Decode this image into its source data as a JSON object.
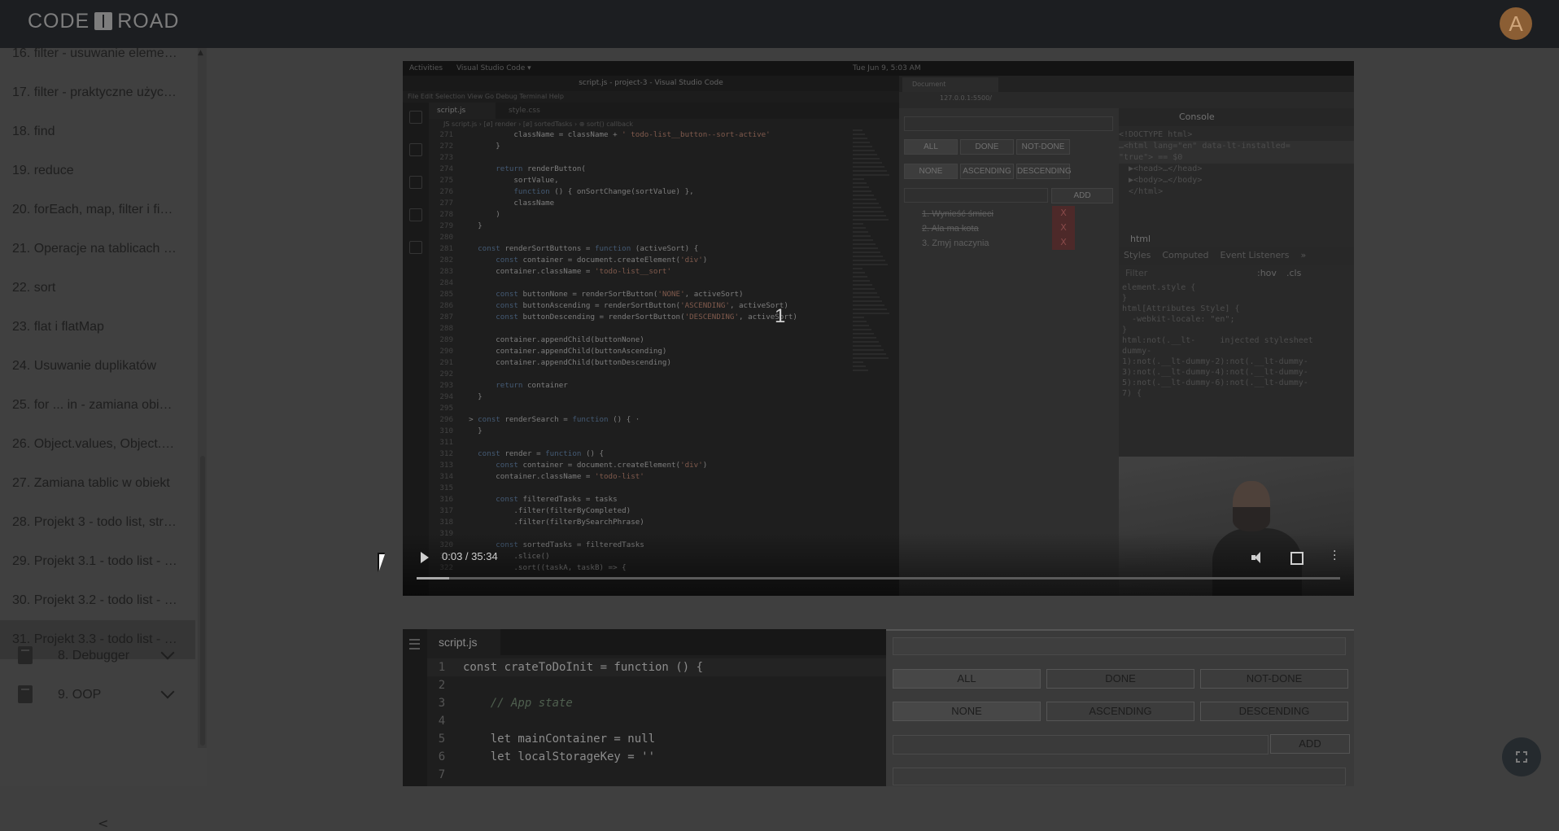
{
  "header": {
    "logo_left": "CODE",
    "logo_right": "ROAD",
    "avatar_letter": "A"
  },
  "sidebar": {
    "lessons": [
      {
        "label": "16. filter - usuwanie eleme…",
        "active": false
      },
      {
        "label": "17. filter - praktyczne użyc…",
        "active": false
      },
      {
        "label": "18. find",
        "active": false
      },
      {
        "label": "19. reduce",
        "active": false
      },
      {
        "label": "20. forEach, map, filter i fi…",
        "active": false
      },
      {
        "label": "21. Operacje na tablicach …",
        "active": false
      },
      {
        "label": "22. sort",
        "active": false
      },
      {
        "label": "23. flat i flatMap",
        "active": false
      },
      {
        "label": "24. Usuwanie duplikatów",
        "active": false
      },
      {
        "label": "25. for ... in - zamiana obi…",
        "active": false
      },
      {
        "label": "26. Object.values, Object.…",
        "active": false
      },
      {
        "label": "27. Zamiana tablic w obiekt",
        "active": false
      },
      {
        "label": "28. Projekt 3 - todo list, str…",
        "active": false
      },
      {
        "label": "29. Projekt 3.1 - todo list - …",
        "active": false
      },
      {
        "label": "30. Projekt 3.2 - todo list - …",
        "active": false
      },
      {
        "label": "31. Projekt 3.3 - todo list - …",
        "active": true
      }
    ],
    "sections": [
      {
        "label": "8. Debugger",
        "icon": "book-icon"
      },
      {
        "label": "9. OOP",
        "icon": "book-icon"
      }
    ],
    "collapse_label": "<"
  },
  "video": {
    "os_bar": {
      "activities": "Activities",
      "app": "Visual Studio Code ▾",
      "clock": "Tue Jun 9, 5:03 AM"
    },
    "vscode": {
      "title": "script.js - project-3 - Visual Studio Code",
      "menu": "File  Edit  Selection  View  Go  Debug  Terminal  Help",
      "tab_active": "script.js",
      "tab_other": "style.css",
      "breadcrumb": "JS script.js › [ø] render › [ø] sortedTasks › ⊕ sort() callback",
      "code_lines": [
        [
          "271",
          "            className = className + ' todo-list__button--sort-active'"
        ],
        [
          "272",
          "        }"
        ],
        [
          "273",
          ""
        ],
        [
          "274",
          "        return renderButton("
        ],
        [
          "275",
          "            sortValue,"
        ],
        [
          "276",
          "            function () { onSortChange(sortValue) },"
        ],
        [
          "277",
          "            className"
        ],
        [
          "278",
          "        )"
        ],
        [
          "279",
          "    }"
        ],
        [
          "280",
          ""
        ],
        [
          "281",
          "    const renderSortButtons = function (activeSort) {"
        ],
        [
          "282",
          "        const container = document.createElement('div')"
        ],
        [
          "283",
          "        container.className = 'todo-list__sort'"
        ],
        [
          "284",
          ""
        ],
        [
          "285",
          "        const buttonNone = renderSortButton('NONE', activeSort)"
        ],
        [
          "286",
          "        const buttonAscending = renderSortButton('ASCENDING', activeSort)"
        ],
        [
          "287",
          "        const buttonDescending = renderSortButton('DESCENDING', activeSort)"
        ],
        [
          "288",
          ""
        ],
        [
          "289",
          "        container.appendChild(buttonNone)"
        ],
        [
          "290",
          "        container.appendChild(buttonAscending)"
        ],
        [
          "291",
          "        container.appendChild(buttonDescending)"
        ],
        [
          "292",
          ""
        ],
        [
          "293",
          "        return container"
        ],
        [
          "294",
          "    }"
        ],
        [
          "295",
          ""
        ],
        [
          "296",
          "  > const renderSearch = function () { ·"
        ],
        [
          "310",
          "    }"
        ],
        [
          "311",
          ""
        ],
        [
          "312",
          "    const render = function () {"
        ],
        [
          "313",
          "        const container = document.createElement('div')"
        ],
        [
          "314",
          "        container.className = 'todo-list'"
        ],
        [
          "315",
          ""
        ],
        [
          "316",
          "        const filteredTasks = tasks"
        ],
        [
          "317",
          "            .filter(filterByCompleted)"
        ],
        [
          "318",
          "            .filter(filterBySearchPhrase)"
        ],
        [
          "319",
          ""
        ],
        [
          "320",
          "        const sortedTasks = filteredTasks"
        ],
        [
          "321",
          "            .slice()"
        ],
        [
          "322",
          "            .sort((taskA, taskB) => {"
        ]
      ]
    },
    "browser": {
      "tab_title": "Document",
      "url": "127.0.0.1:5500/",
      "filter_buttons": [
        "ALL",
        "DONE",
        "NOT-DONE"
      ],
      "sort_buttons": [
        "NONE",
        "ASCENDING",
        "DESCENDING"
      ],
      "add_label": "ADD",
      "tasks": [
        {
          "label": "1. Wynieść śmieci",
          "done": true
        },
        {
          "label": "2. Ala ma kota",
          "done": true
        },
        {
          "label": "3. Zmyj naczynia",
          "done": false
        }
      ],
      "delete_label": "X"
    },
    "devtools": {
      "console_tab": "Console",
      "html_lines": [
        "<!DOCTYPE html>",
        "…<html lang=\"en\" data-lt-installed=",
        "\"true\"> == $0",
        "  ▶<head>…</head>",
        "  ▶<body>…</body>",
        "  </html>"
      ],
      "selected": "html",
      "style_tabs": [
        "Styles",
        "Computed",
        "Event Listeners",
        "»"
      ],
      "filter_placeholder": "Filter",
      "hov": ":hov",
      "cls": ".cls",
      "css_lines": "element.style {\n}\nhtml[Attributes Style] {\n  -webkit-locale: \"en\";\n}\nhtml:not(.__lt-     injected stylesheet\ndummy-\n1):not(.__lt-dummy-2):not(.__lt-dummy-\n3):not(.__lt-dummy-4):not(.__lt-dummy-\n5):not(.__lt-dummy-6):not(.__lt-dummy-\n7) {"
    },
    "center_number": "1",
    "time": "0:03 / 35:34",
    "progress_fraction": 0.0014
  },
  "editor": {
    "tab": "script.js",
    "lines": [
      {
        "n": "1",
        "code": "const crateToDoInit = function () {"
      },
      {
        "n": "2",
        "code": ""
      },
      {
        "n": "3",
        "code": "    // App state"
      },
      {
        "n": "4",
        "code": ""
      },
      {
        "n": "5",
        "code": "    let mainContainer = null"
      },
      {
        "n": "6",
        "code": "    let localStorageKey = ''"
      },
      {
        "n": "7",
        "code": ""
      }
    ]
  },
  "preview": {
    "filter_buttons": [
      "ALL",
      "DONE",
      "NOT-DONE"
    ],
    "sort_buttons": [
      "NONE",
      "ASCENDING",
      "DESCENDING"
    ],
    "add_label": "ADD"
  }
}
